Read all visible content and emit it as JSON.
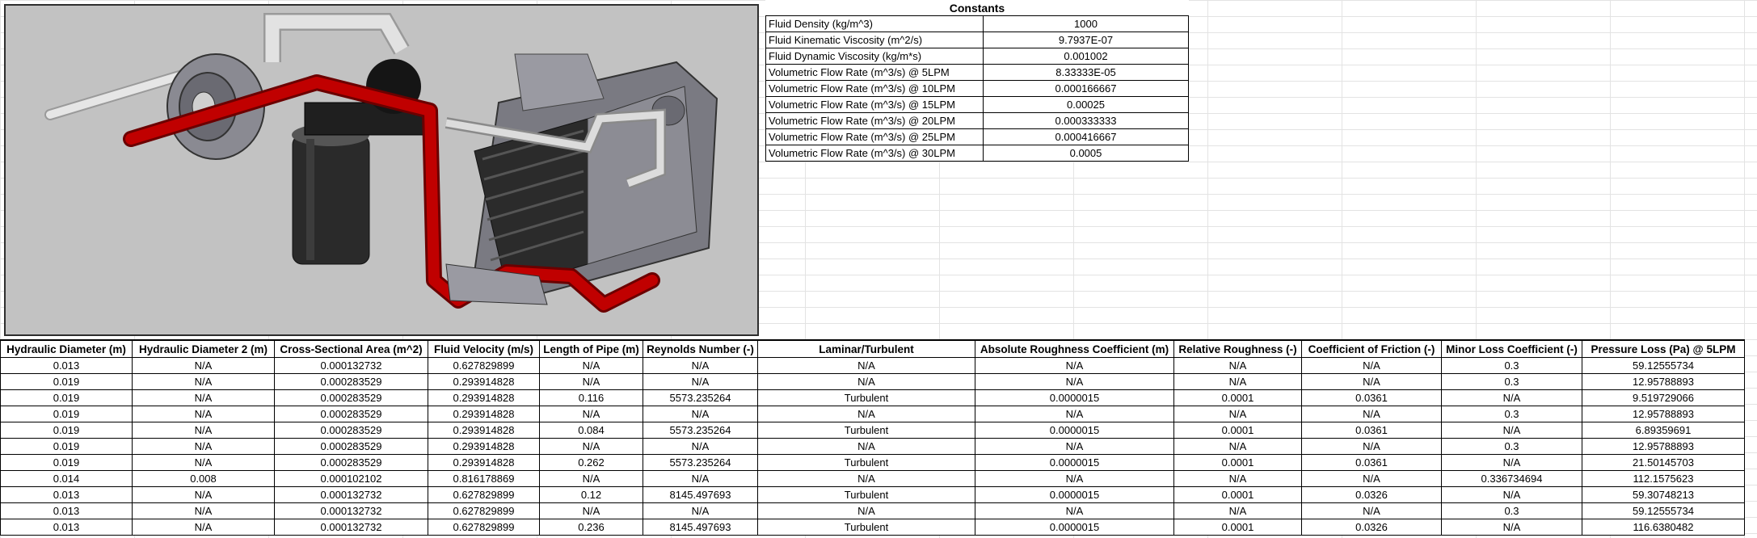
{
  "constants": {
    "title": "Constants",
    "rows": [
      {
        "label": "Fluid Density (kg/m^3)",
        "value": "1000"
      },
      {
        "label": "Fluid Kinematic Viscosity (m^2/s)",
        "value": "9.7937E-07"
      },
      {
        "label": "Fluid Dynamic Viscosity (kg/m*s)",
        "value": "0.001002"
      },
      {
        "label": "Volumetric Flow Rate (m^3/s) @ 5LPM",
        "value": "8.33333E-05"
      },
      {
        "label": "Volumetric Flow Rate (m^3/s) @ 10LPM",
        "value": "0.000166667"
      },
      {
        "label": "Volumetric Flow Rate (m^3/s) @ 15LPM",
        "value": "0.00025"
      },
      {
        "label": "Volumetric Flow Rate (m^3/s) @ 20LPM",
        "value": "0.000333333"
      },
      {
        "label": "Volumetric Flow Rate (m^3/s) @ 25LPM",
        "value": "0.000416667"
      },
      {
        "label": "Volumetric Flow Rate (m^3/s) @ 30LPM",
        "value": "0.0005"
      }
    ]
  },
  "table": {
    "headers": [
      "Hydraulic Diameter (m)",
      "Hydraulic Diameter 2 (m)",
      "Cross-Sectional Area (m^2)",
      "Fluid Velocity (m/s)",
      "Length of Pipe (m)",
      "Reynolds Number (-)",
      "Laminar/Turbulent",
      "Absolute Roughness Coefficient (m)",
      "Relative Roughness (-)",
      "Coefficient of Friction (-)",
      "Minor Loss Coefficient (-)",
      "Pressure Loss (Pa) @ 5LPM"
    ],
    "rows": [
      [
        "0.013",
        "N/A",
        "0.000132732",
        "0.627829899",
        "N/A",
        "N/A",
        "N/A",
        "N/A",
        "N/A",
        "N/A",
        "0.3",
        "59.12555734"
      ],
      [
        "0.019",
        "N/A",
        "0.000283529",
        "0.293914828",
        "N/A",
        "N/A",
        "N/A",
        "N/A",
        "N/A",
        "N/A",
        "0.3",
        "12.95788893"
      ],
      [
        "0.019",
        "N/A",
        "0.000283529",
        "0.293914828",
        "0.116",
        "5573.235264",
        "Turbulent",
        "0.0000015",
        "0.0001",
        "0.0361",
        "N/A",
        "9.519729066"
      ],
      [
        "0.019",
        "N/A",
        "0.000283529",
        "0.293914828",
        "N/A",
        "N/A",
        "N/A",
        "N/A",
        "N/A",
        "N/A",
        "0.3",
        "12.95788893"
      ],
      [
        "0.019",
        "N/A",
        "0.000283529",
        "0.293914828",
        "0.084",
        "5573.235264",
        "Turbulent",
        "0.0000015",
        "0.0001",
        "0.0361",
        "N/A",
        "6.89359691"
      ],
      [
        "0.019",
        "N/A",
        "0.000283529",
        "0.293914828",
        "N/A",
        "N/A",
        "N/A",
        "N/A",
        "N/A",
        "N/A",
        "0.3",
        "12.95788893"
      ],
      [
        "0.019",
        "N/A",
        "0.000283529",
        "0.293914828",
        "0.262",
        "5573.235264",
        "Turbulent",
        "0.0000015",
        "0.0001",
        "0.0361",
        "N/A",
        "21.50145703"
      ],
      [
        "0.014",
        "0.008",
        "0.000102102",
        "0.816178869",
        "N/A",
        "N/A",
        "N/A",
        "N/A",
        "N/A",
        "N/A",
        "0.336734694",
        "112.1575623"
      ],
      [
        "0.013",
        "N/A",
        "0.000132732",
        "0.627829899",
        "0.12",
        "8145.497693",
        "Turbulent",
        "0.0000015",
        "0.0001",
        "0.0326",
        "N/A",
        "59.30748213"
      ],
      [
        "0.013",
        "N/A",
        "0.000132732",
        "0.627829899",
        "N/A",
        "N/A",
        "N/A",
        "N/A",
        "N/A",
        "N/A",
        "0.3",
        "59.12555734"
      ],
      [
        "0.013",
        "N/A",
        "0.000132732",
        "0.627829899",
        "0.236",
        "8145.497693",
        "Turbulent",
        "0.0000015",
        "0.0001",
        "0.0326",
        "N/A",
        "116.6380482"
      ]
    ]
  },
  "colors": {
    "pipe_red": "#c00000",
    "metal_grey": "#7a7a82",
    "background_grey": "#c2c2c2"
  }
}
